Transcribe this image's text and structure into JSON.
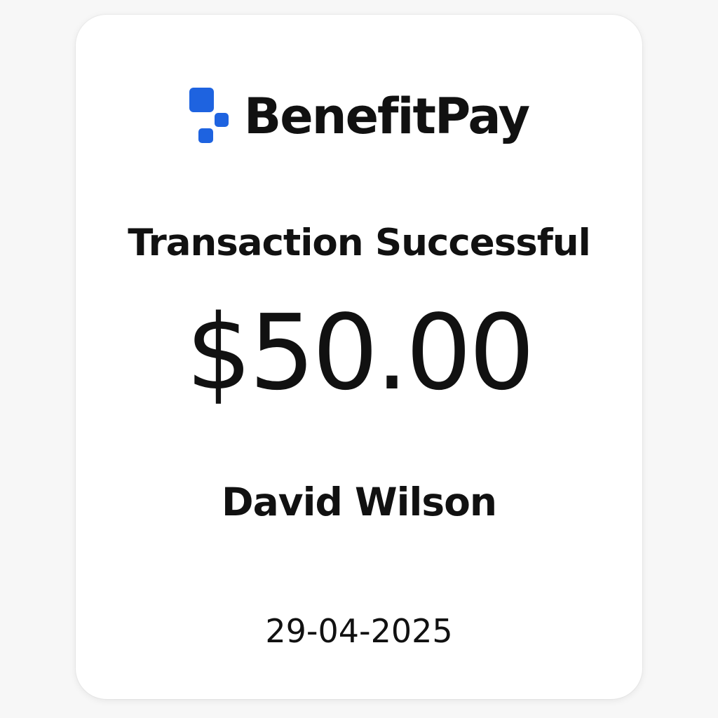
{
  "brand": {
    "name": "BenefitPay",
    "logo_icon": "benefitpay-squares-logo",
    "accent_color": "#1e63e0"
  },
  "receipt": {
    "status": "Transaction Successful",
    "amount": "$50.00",
    "recipient": "David Wilson",
    "date": "29-04-2025"
  }
}
